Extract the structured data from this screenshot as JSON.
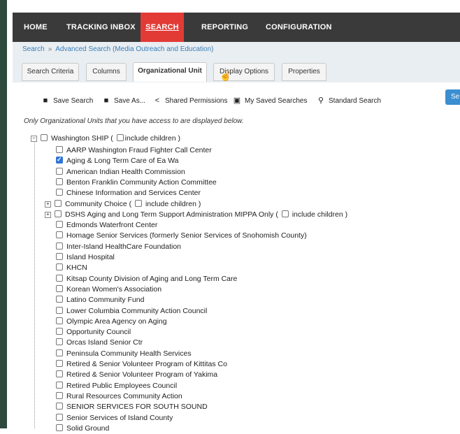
{
  "nav": {
    "items": [
      {
        "label": "HOME"
      },
      {
        "label": "TRACKING INBOX"
      },
      {
        "label": "SEARCH",
        "active": true
      },
      {
        "label": "REPORTING"
      },
      {
        "label": "CONFIGURATION"
      }
    ],
    "active_color": "#e23b36"
  },
  "breadcrumb": {
    "items": [
      "Search",
      "Advanced Search (Media Outreach and Education)"
    ],
    "separator": "»"
  },
  "tabs": [
    {
      "label": "Search Criteria"
    },
    {
      "label": "Columns"
    },
    {
      "label": "Organizational Unit",
      "active": true
    },
    {
      "label": "Display Options"
    },
    {
      "label": "Properties"
    }
  ],
  "toolbar": {
    "save_search": "Save Search",
    "save_as": "Save As...",
    "shared_permissions": "Shared Permissions",
    "my_saved_searches": "My Saved Searches",
    "standard_search": "Standard Search",
    "search_button": "Se"
  },
  "note": "Only Organizational Units that you have access to are displayed below.",
  "tree": {
    "include_children_label": "include children )",
    "root": {
      "label": "Washington SHIP (",
      "expander": "−"
    },
    "children": [
      {
        "label": "AARP Washington Fraud Fighter Call Center",
        "checked": false,
        "expander": false
      },
      {
        "label": "Aging & Long Term Care of Ea Wa",
        "checked": true,
        "expander": false
      },
      {
        "label": "American Indian Health Commission",
        "checked": false,
        "expander": false
      },
      {
        "label": "Benton Franklin Community Action Committee",
        "checked": false,
        "expander": false
      },
      {
        "label": "Chinese Information and Services Center",
        "checked": false,
        "expander": false
      },
      {
        "label": "Community Choice (",
        "checked": false,
        "expander": true,
        "include_children": true
      },
      {
        "label": "DSHS Aging and Long Term Support Administration MIPPA Only (",
        "checked": false,
        "expander": true,
        "include_children": true
      },
      {
        "label": "Edmonds Waterfront Center",
        "checked": false,
        "expander": false
      },
      {
        "label": "Homage Senior Services (formerly Senior Services of Snohomish County)",
        "checked": false,
        "expander": false
      },
      {
        "label": "Inter-Island HealthCare Foundation",
        "checked": false,
        "expander": false
      },
      {
        "label": "Island Hospital",
        "checked": false,
        "expander": false
      },
      {
        "label": "KHCN",
        "checked": false,
        "expander": false
      },
      {
        "label": "Kitsap County Division of Aging and Long Term Care",
        "checked": false,
        "expander": false
      },
      {
        "label": "Korean Women's Association",
        "checked": false,
        "expander": false
      },
      {
        "label": "Latino Community Fund",
        "checked": false,
        "expander": false
      },
      {
        "label": "Lower Columbia Community Action Council",
        "checked": false,
        "expander": false
      },
      {
        "label": "Olympic Area Agency on Aging",
        "checked": false,
        "expander": false
      },
      {
        "label": "Opportunity Council",
        "checked": false,
        "expander": false
      },
      {
        "label": "Orcas Island Senior Ctr",
        "checked": false,
        "expander": false
      },
      {
        "label": "Peninsula Community Health Services",
        "checked": false,
        "expander": false
      },
      {
        "label": "Retired & Senior Volunteer Program of Kittitas Co",
        "checked": false,
        "expander": false
      },
      {
        "label": "Retired & Senior Volunteer Program of Yakima",
        "checked": false,
        "expander": false
      },
      {
        "label": "Retired Public Employees Council",
        "checked": false,
        "expander": false
      },
      {
        "label": "Rural Resources Community Action",
        "checked": false,
        "expander": false
      },
      {
        "label": "SENIOR SERVICES FOR SOUTH SOUND",
        "checked": false,
        "expander": false
      },
      {
        "label": "Senior Services of Island County",
        "checked": false,
        "expander": false
      },
      {
        "label": "Solid Ground",
        "checked": false,
        "expander": false
      }
    ]
  },
  "icons": {
    "save": "save-icon",
    "save_as": "save-as-icon",
    "share": "share-icon",
    "saved_searches": "saved-searches-icon",
    "search": "search-icon",
    "cursor": "pointer-cursor-icon"
  }
}
